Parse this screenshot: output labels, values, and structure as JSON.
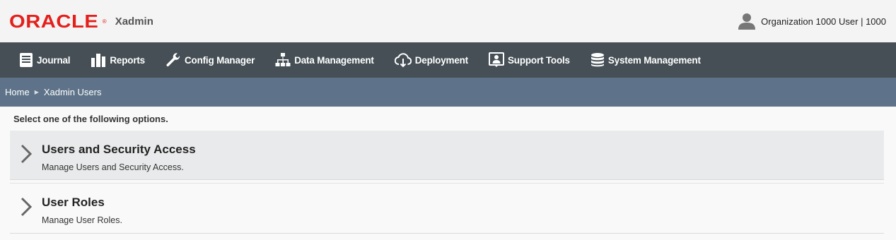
{
  "header": {
    "logo_text": "ORACLE",
    "logo_mark": "®",
    "app_name": "Xadmin",
    "user_label": "Organization 1000 User | 1000",
    "brand_color": "#e4201b"
  },
  "nav": {
    "items": [
      {
        "label": "Journal",
        "icon": "journal-icon"
      },
      {
        "label": "Reports",
        "icon": "reports-icon"
      },
      {
        "label": "Config Manager",
        "icon": "wrench-icon"
      },
      {
        "label": "Data Management",
        "icon": "hierarchy-icon"
      },
      {
        "label": "Deployment",
        "icon": "cloud-download-icon"
      },
      {
        "label": "Support Tools",
        "icon": "support-icon"
      },
      {
        "label": "System Management",
        "icon": "database-icon"
      }
    ]
  },
  "breadcrumb": {
    "home": "Home",
    "current": "Xadmin Users"
  },
  "main": {
    "prompt": "Select one of the following options.",
    "options": [
      {
        "title": "Users and Security Access",
        "description": "Manage Users and Security Access."
      },
      {
        "title": "User Roles",
        "description": "Manage User Roles."
      }
    ]
  }
}
